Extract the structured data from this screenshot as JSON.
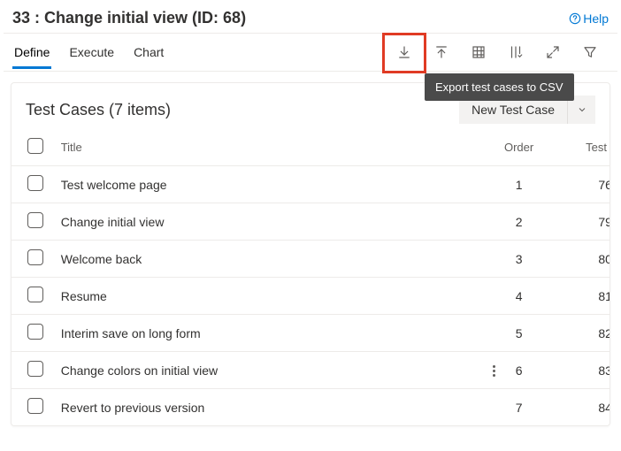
{
  "header": {
    "title": "33 : Change initial view (ID: 68)",
    "help": "Help"
  },
  "tabs": [
    "Define",
    "Execute",
    "Chart"
  ],
  "active_tab": 0,
  "toolbar": {
    "tooltip": "Export test cases to CSV"
  },
  "panel": {
    "title": "Test Cases (7 items)",
    "new_btn": "New Test Case"
  },
  "columns": {
    "title": "Title",
    "order": "Order",
    "tc": "Test Ca"
  },
  "rows": [
    {
      "title": "Test welcome page",
      "order": "1",
      "tc": "76"
    },
    {
      "title": "Change initial view",
      "order": "2",
      "tc": "79"
    },
    {
      "title": "Welcome back",
      "order": "3",
      "tc": "80"
    },
    {
      "title": "Resume",
      "order": "4",
      "tc": "81"
    },
    {
      "title": "Interim save on long form",
      "order": "5",
      "tc": "82"
    },
    {
      "title": "Change colors on initial view",
      "order": "6",
      "tc": "83",
      "more": true
    },
    {
      "title": "Revert to previous version",
      "order": "7",
      "tc": "84"
    }
  ]
}
